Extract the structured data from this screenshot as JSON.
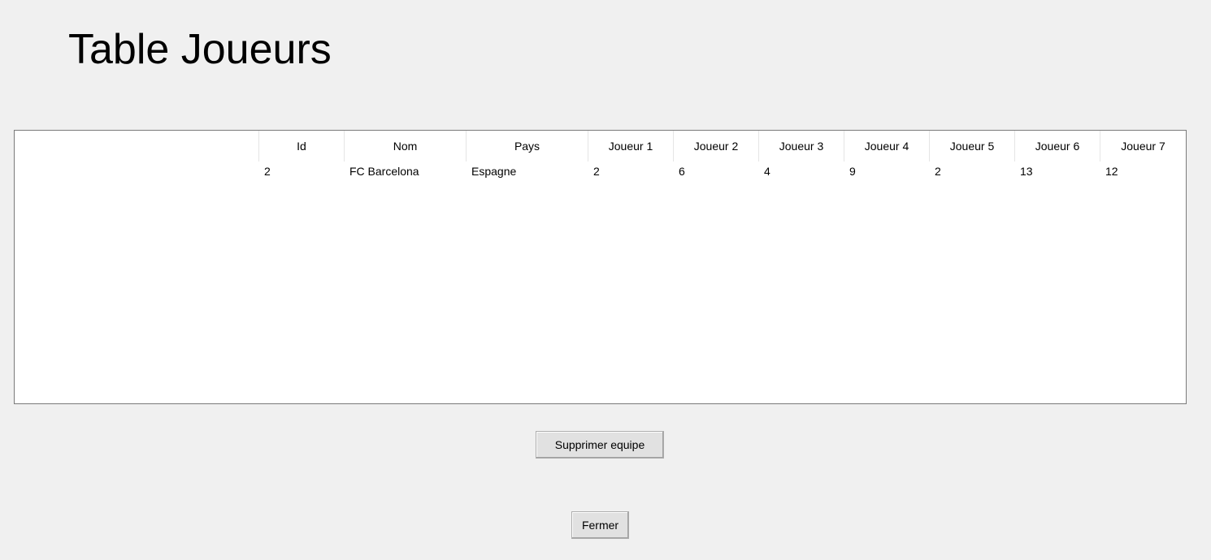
{
  "window": {
    "title": "Table Joueurs"
  },
  "table": {
    "columns": [
      "",
      "Id",
      "Nom",
      "Pays",
      "Joueur 1",
      "Joueur 2",
      "Joueur 3",
      "Joueur 4",
      "Joueur 5",
      "Joueur 6",
      "Joueur 7"
    ],
    "rows": [
      [
        "",
        "2",
        "FC Barcelona",
        "Espagne",
        "2",
        "6",
        "4",
        "9",
        "2",
        "13",
        "12"
      ]
    ]
  },
  "buttons": {
    "delete_label": "Supprimer equipe",
    "close_label": "Fermer"
  }
}
